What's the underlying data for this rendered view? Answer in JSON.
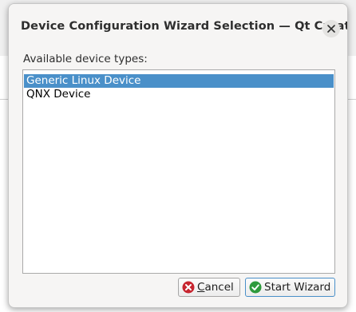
{
  "dialog": {
    "title": "Device Configuration Wizard Selection — Qt Creator",
    "prompt_label": "Available device types:",
    "device_types": [
      {
        "label": "Generic Linux Device",
        "selected": true
      },
      {
        "label": "QNX Device",
        "selected": false
      }
    ],
    "buttons": {
      "cancel_label": "Cancel",
      "start_label": "Start Wizard"
    },
    "icons": {
      "close": "close-icon",
      "cancel": "cancel-icon",
      "start": "checkmark-icon"
    },
    "colors": {
      "selection": "#4a90c9",
      "cancel_icon": "#c7252f",
      "start_icon": "#2e9a3c"
    }
  }
}
